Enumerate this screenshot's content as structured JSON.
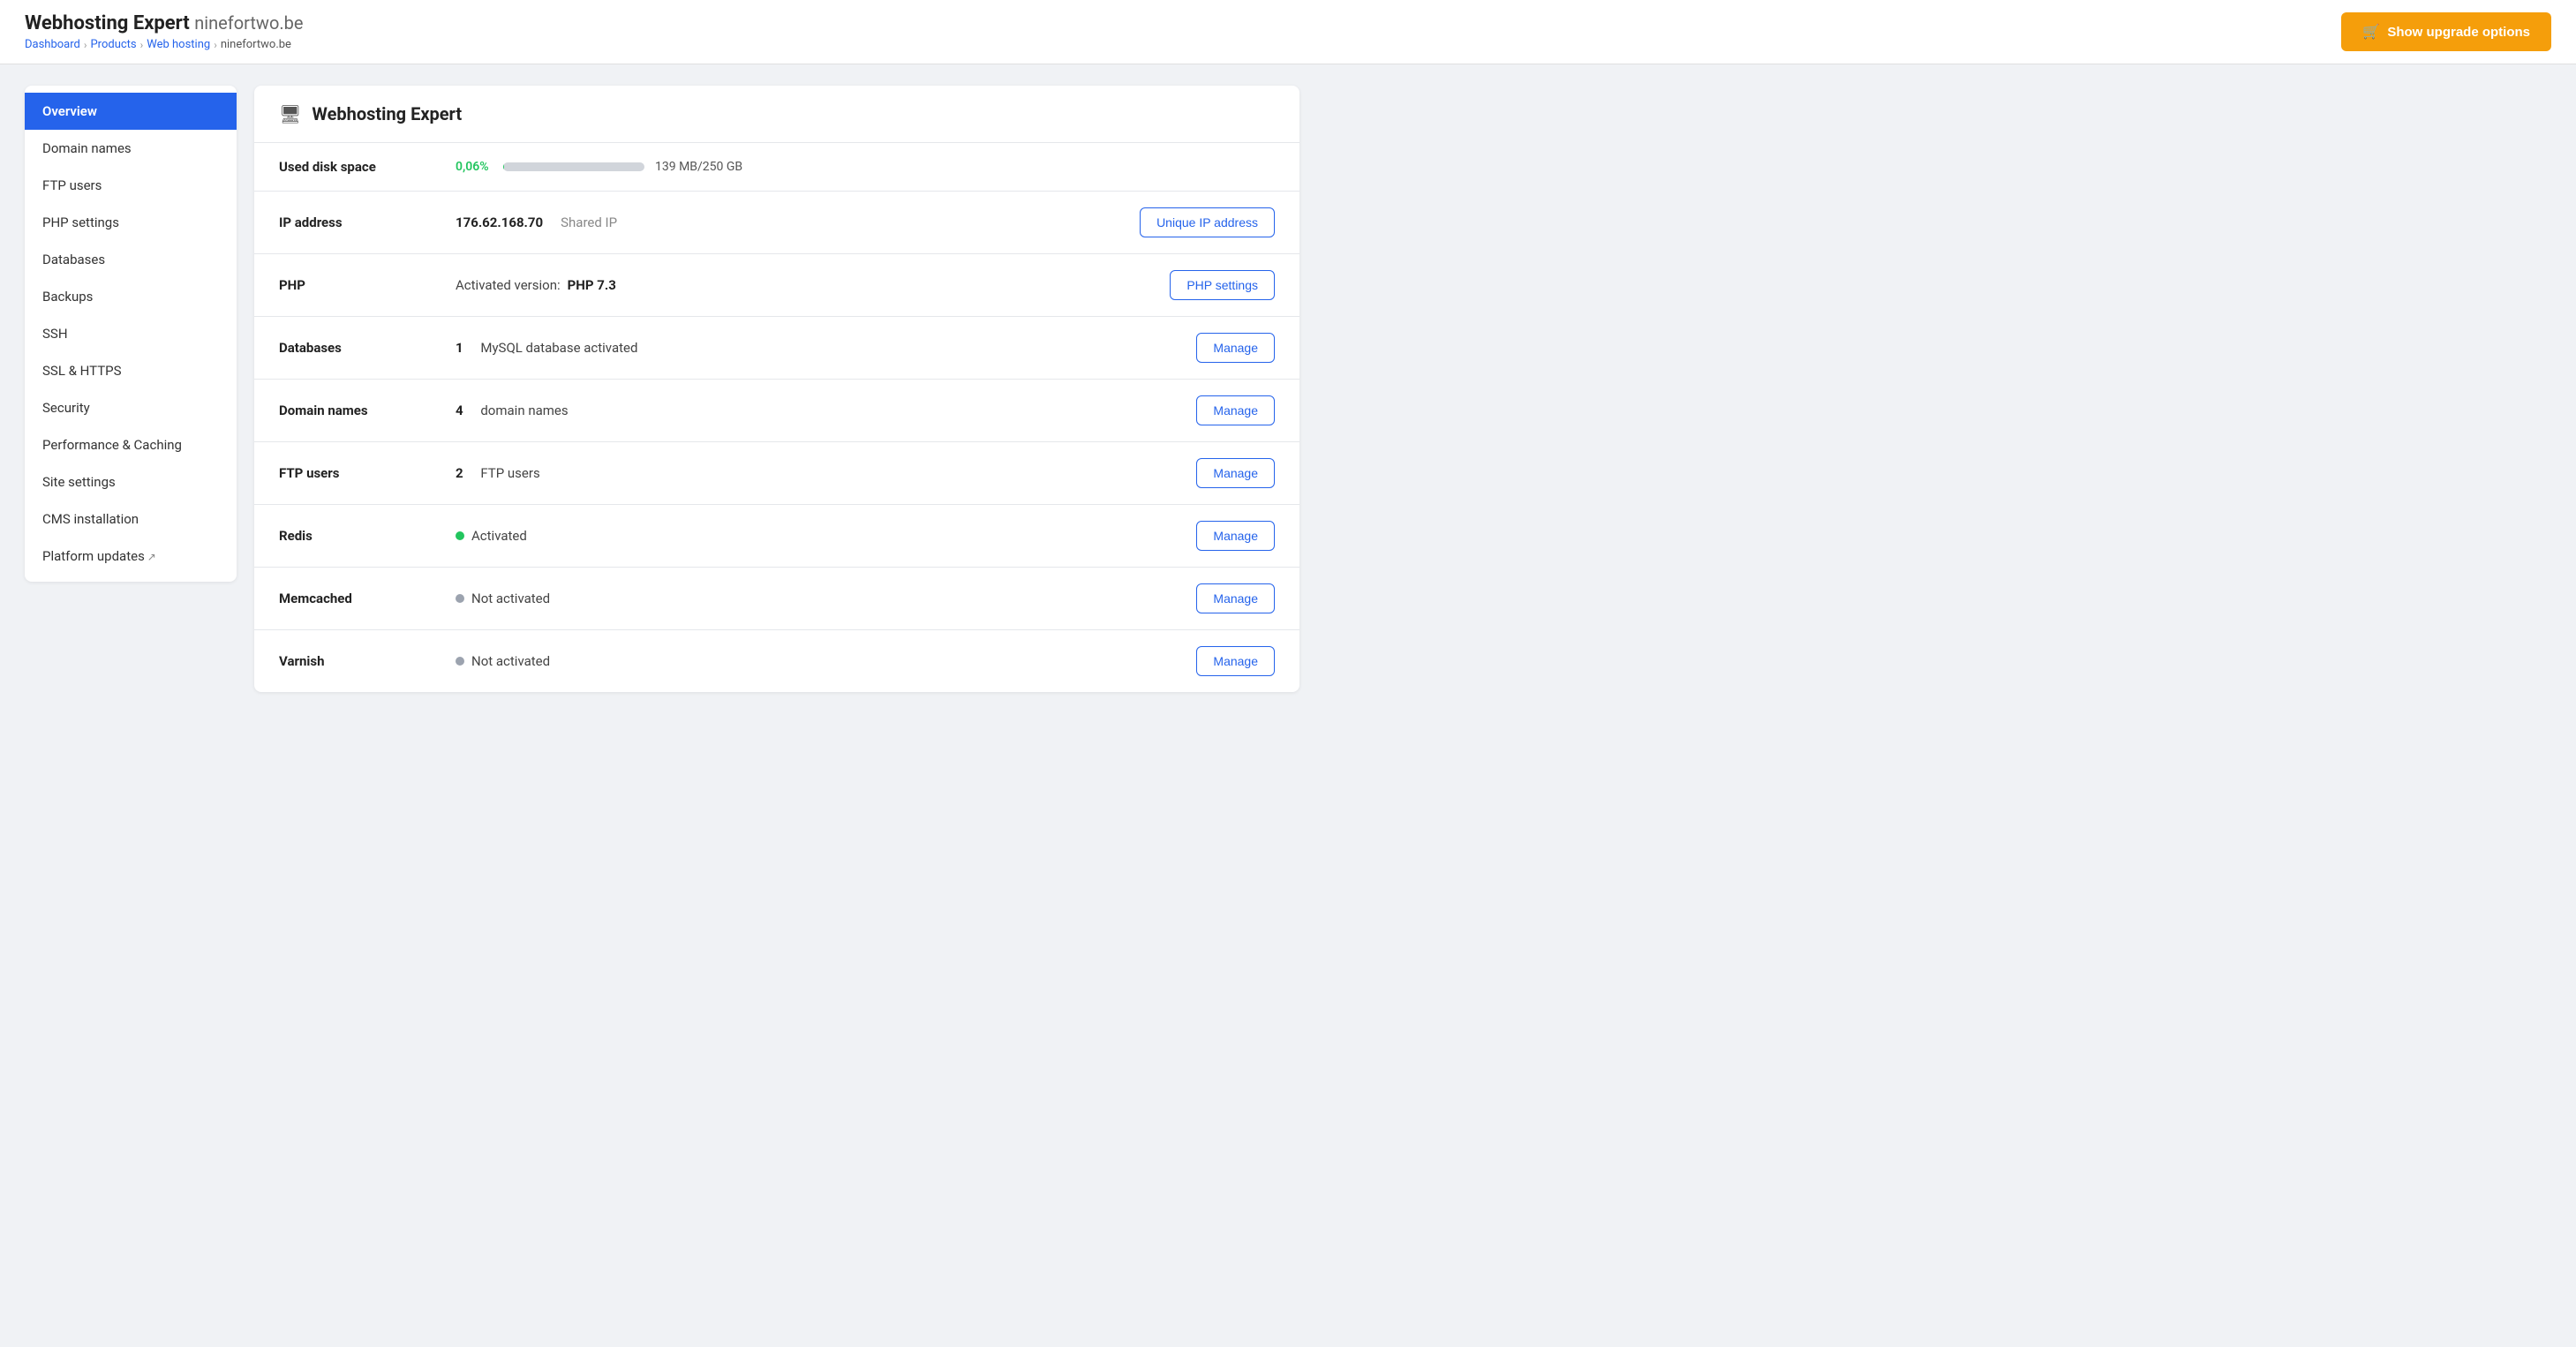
{
  "header": {
    "title": "Webhosting Expert",
    "subtitle": "ninefortwo.be",
    "breadcrumb": [
      {
        "label": "Dashboard",
        "href": "#"
      },
      {
        "label": "Products",
        "href": "#"
      },
      {
        "label": "Web hosting",
        "href": "#"
      },
      {
        "label": "ninefortwo.be",
        "href": null
      }
    ],
    "upgrade_button": "Show upgrade options"
  },
  "sidebar": {
    "items": [
      {
        "label": "Overview",
        "active": true,
        "external": false
      },
      {
        "label": "Domain names",
        "active": false,
        "external": false
      },
      {
        "label": "FTP users",
        "active": false,
        "external": false
      },
      {
        "label": "PHP settings",
        "active": false,
        "external": false
      },
      {
        "label": "Databases",
        "active": false,
        "external": false
      },
      {
        "label": "Backups",
        "active": false,
        "external": false
      },
      {
        "label": "SSH",
        "active": false,
        "external": false
      },
      {
        "label": "SSL & HTTPS",
        "active": false,
        "external": false
      },
      {
        "label": "Security",
        "active": false,
        "external": false
      },
      {
        "label": "Performance & Caching",
        "active": false,
        "external": false
      },
      {
        "label": "Site settings",
        "active": false,
        "external": false
      },
      {
        "label": "CMS installation",
        "active": false,
        "external": false
      },
      {
        "label": "Platform updates",
        "active": false,
        "external": true
      }
    ]
  },
  "content": {
    "title": "Webhosting Expert",
    "rows": [
      {
        "label": "Used disk space",
        "type": "disk",
        "percent": "0,06%",
        "size": "139 MB/250 GB"
      },
      {
        "label": "IP address",
        "type": "ip",
        "ip": "176.62.168.70",
        "ip_type": "Shared IP",
        "action": "Unique IP address"
      },
      {
        "label": "PHP",
        "type": "php",
        "text_prefix": "Activated version: ",
        "version": "PHP 7.3",
        "action": "PHP settings"
      },
      {
        "label": "Databases",
        "type": "text",
        "count": "1",
        "text": "MySQL database activated",
        "action": "Manage"
      },
      {
        "label": "Domain names",
        "type": "text",
        "count": "4",
        "text": "domain names",
        "action": "Manage"
      },
      {
        "label": "FTP users",
        "type": "text",
        "count": "2",
        "text": "FTP users",
        "action": "Manage"
      },
      {
        "label": "Redis",
        "type": "status",
        "status": "green",
        "status_text": "Activated",
        "action": "Manage"
      },
      {
        "label": "Memcached",
        "type": "status",
        "status": "gray",
        "status_text": "Not activated",
        "action": "Manage"
      },
      {
        "label": "Varnish",
        "type": "status",
        "status": "gray",
        "status_text": "Not activated",
        "action": "Manage"
      }
    ]
  }
}
